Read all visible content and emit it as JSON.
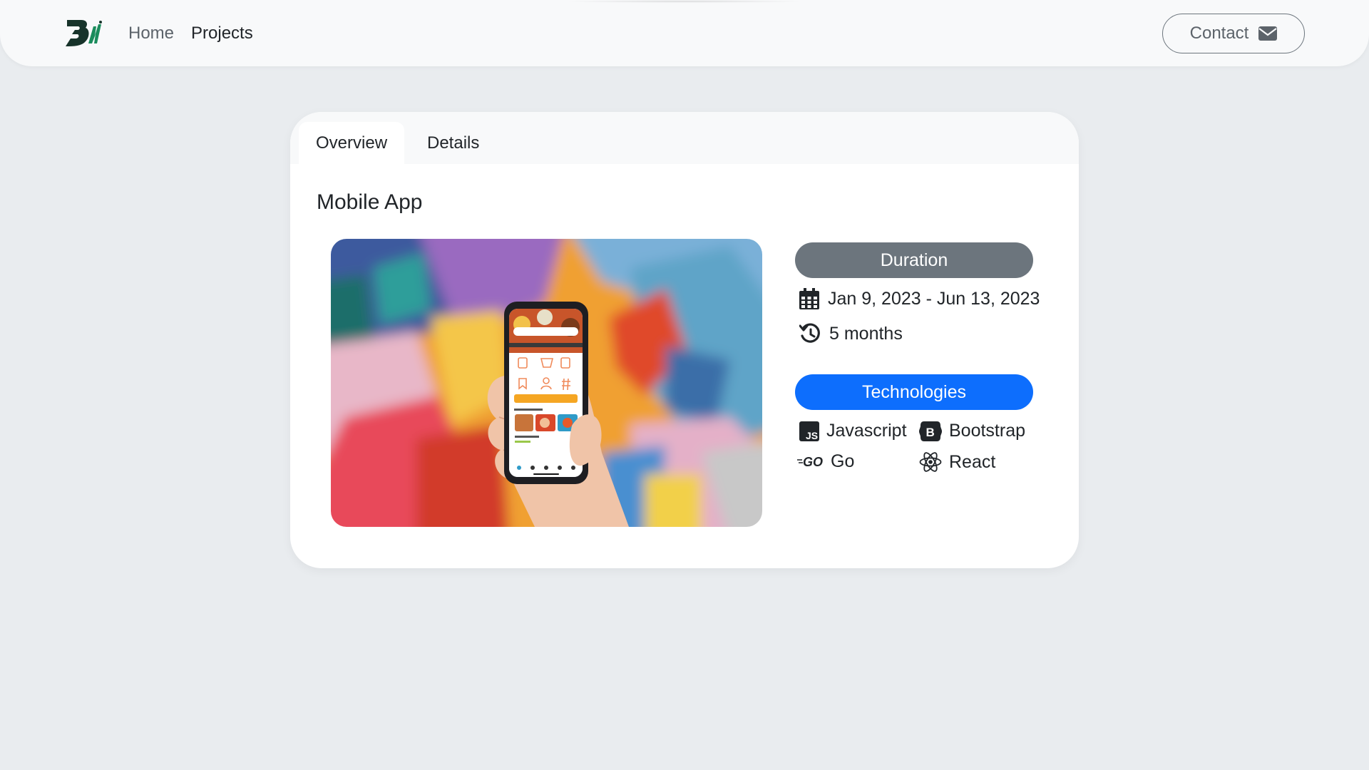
{
  "nav": {
    "logo": "brand-logo",
    "links": [
      {
        "label": "Home",
        "active": false
      },
      {
        "label": "Projects",
        "active": true
      }
    ],
    "contact_label": "Contact",
    "contact_icon": "envelope-icon"
  },
  "card": {
    "tabs": [
      {
        "label": "Overview",
        "active": true
      },
      {
        "label": "Details",
        "active": false
      }
    ],
    "title": "Mobile App",
    "image_alt": "hand holding phone with food app in front of colorful mural"
  },
  "duration": {
    "header": "Duration",
    "dates": "Jan 9, 2023 - Jun 13, 2023",
    "dates_icon": "calendar-icon",
    "length": "5 months",
    "length_icon": "history-icon"
  },
  "technologies": {
    "header": "Technologies",
    "items": [
      {
        "label": "Javascript",
        "icon": "javascript-icon"
      },
      {
        "label": "Bootstrap",
        "icon": "bootstrap-icon"
      },
      {
        "label": "Go",
        "icon": "go-icon"
      },
      {
        "label": "React",
        "icon": "react-icon"
      }
    ]
  },
  "colors": {
    "background": "#e9ecef",
    "navbar": "#f8f9fa",
    "duration_pill": "#6c757d",
    "tech_pill": "#0d6efd",
    "logo_green": "#1a8c5c"
  }
}
